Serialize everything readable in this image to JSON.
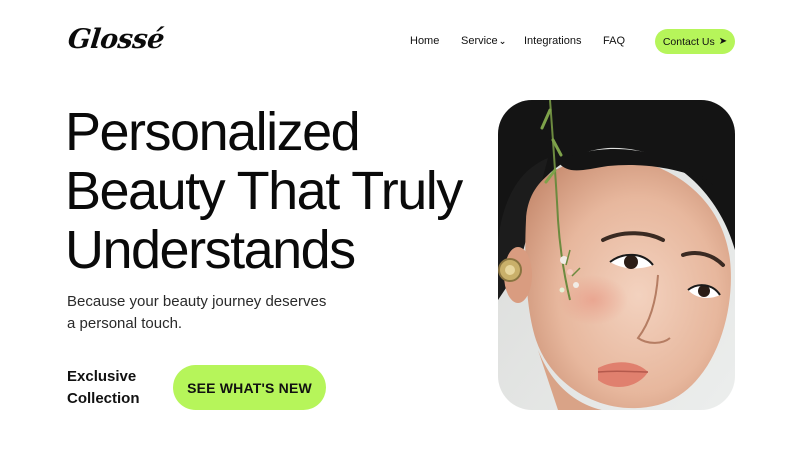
{
  "brand": {
    "logo_text": "Glossé"
  },
  "nav": {
    "items": [
      {
        "label": "Home"
      },
      {
        "label": "Service"
      },
      {
        "label": "Integrations"
      },
      {
        "label": "FAQ"
      }
    ],
    "contact_label": "Contact Us",
    "contact_arrow": "➤",
    "service_chevron": "⌄"
  },
  "hero": {
    "title_lines": [
      "Personalized",
      "Beauty That Truly",
      "Understands"
    ],
    "subtitle_lines": [
      "Because your beauty journey deserves",
      "a personal touch."
    ],
    "exclusive_lines": [
      "Exclusive",
      "Collection"
    ],
    "cta_label": "SEE WHAT'S NEW",
    "image_subject": "portrait-photo"
  },
  "colors": {
    "accent": "#b6f55a",
    "text": "#111111",
    "background": "#ffffff"
  }
}
